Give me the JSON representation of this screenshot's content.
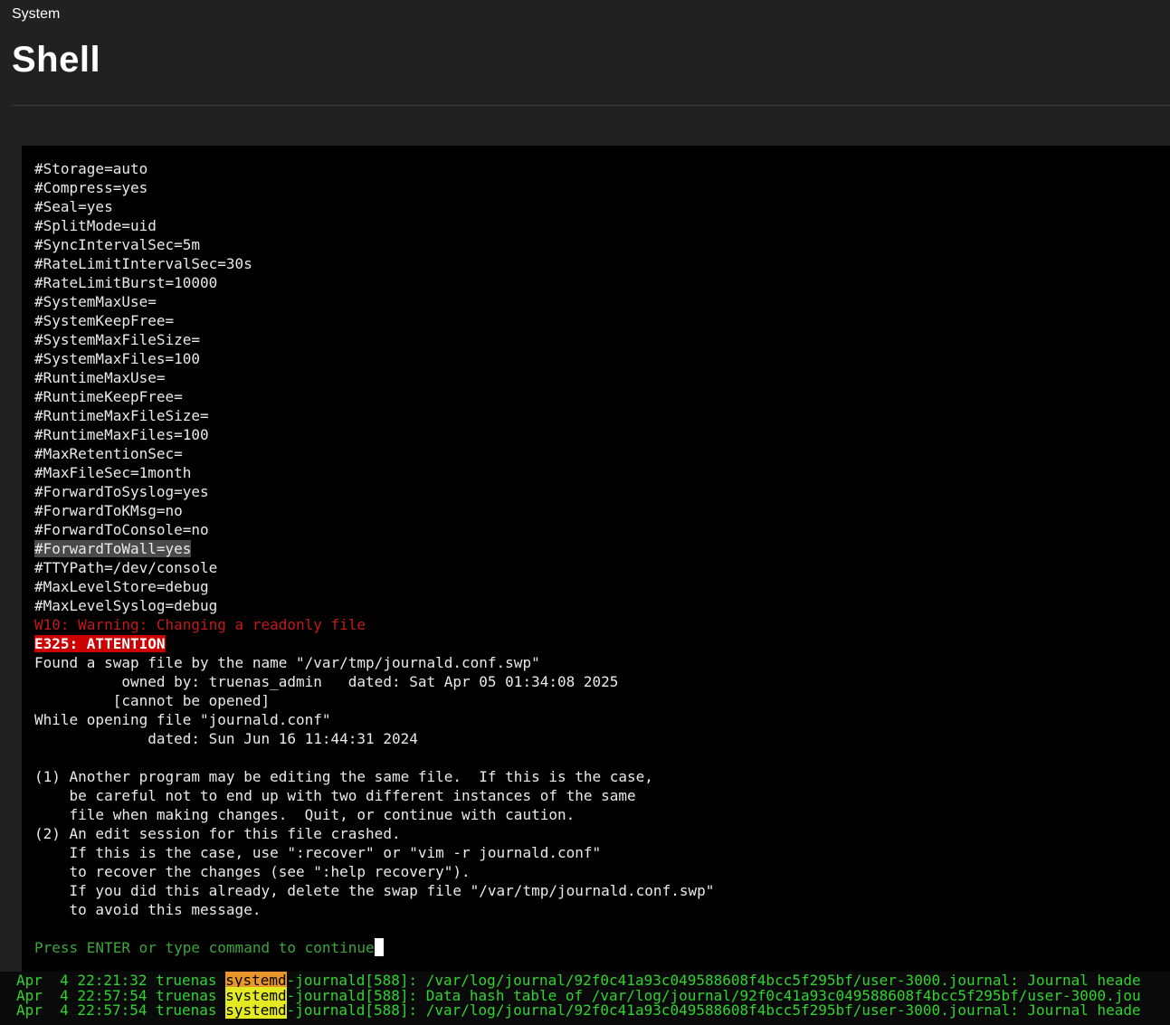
{
  "header": {
    "breadcrumb": "System",
    "title": "Shell"
  },
  "terminal": {
    "lines": [
      {
        "text": "#Storage=auto",
        "style": "normal"
      },
      {
        "text": "#Compress=yes",
        "style": "normal"
      },
      {
        "text": "#Seal=yes",
        "style": "normal"
      },
      {
        "text": "#SplitMode=uid",
        "style": "normal"
      },
      {
        "text": "#SyncIntervalSec=5m",
        "style": "normal"
      },
      {
        "text": "#RateLimitIntervalSec=30s",
        "style": "normal"
      },
      {
        "text": "#RateLimitBurst=10000",
        "style": "normal"
      },
      {
        "text": "#SystemMaxUse=",
        "style": "normal"
      },
      {
        "text": "#SystemKeepFree=",
        "style": "normal"
      },
      {
        "text": "#SystemMaxFileSize=",
        "style": "normal"
      },
      {
        "text": "#SystemMaxFiles=100",
        "style": "normal"
      },
      {
        "text": "#RuntimeMaxUse=",
        "style": "normal"
      },
      {
        "text": "#RuntimeKeepFree=",
        "style": "normal"
      },
      {
        "text": "#RuntimeMaxFileSize=",
        "style": "normal"
      },
      {
        "text": "#RuntimeMaxFiles=100",
        "style": "normal"
      },
      {
        "text": "#MaxRetentionSec=",
        "style": "normal"
      },
      {
        "text": "#MaxFileSec=1month",
        "style": "normal"
      },
      {
        "text": "#ForwardToSyslog=yes",
        "style": "normal"
      },
      {
        "text": "#ForwardToKMsg=no",
        "style": "normal"
      },
      {
        "text": "#ForwardToConsole=no",
        "style": "normal"
      },
      {
        "text": "#ForwardToWall=yes",
        "style": "highlighted"
      },
      {
        "text": "#TTYPath=/dev/console",
        "style": "normal"
      },
      {
        "text": "#MaxLevelStore=debug",
        "style": "normal"
      },
      {
        "text": "#MaxLevelSyslog=debug",
        "style": "normal"
      },
      {
        "text": "W10: Warning: Changing a readonly file",
        "style": "warning"
      },
      {
        "text": "E325: ATTENTION",
        "style": "error"
      },
      {
        "text": "Found a swap file by the name \"/var/tmp/journald.conf.swp\"",
        "style": "normal"
      },
      {
        "text": "          owned by: truenas_admin   dated: Sat Apr 05 01:34:08 2025",
        "style": "normal"
      },
      {
        "text": "         [cannot be opened]",
        "style": "normal"
      },
      {
        "text": "While opening file \"journald.conf\"",
        "style": "normal"
      },
      {
        "text": "             dated: Sun Jun 16 11:44:31 2024",
        "style": "normal"
      },
      {
        "text": "",
        "style": "normal"
      },
      {
        "text": "(1) Another program may be editing the same file.  If this is the case,",
        "style": "normal"
      },
      {
        "text": "    be careful not to end up with two different instances of the same",
        "style": "normal"
      },
      {
        "text": "    file when making changes.  Quit, or continue with caution.",
        "style": "normal"
      },
      {
        "text": "(2) An edit session for this file crashed.",
        "style": "normal"
      },
      {
        "text": "    If this is the case, use \":recover\" or \"vim -r journald.conf\"",
        "style": "normal"
      },
      {
        "text": "    to recover the changes (see \":help recovery\").",
        "style": "normal"
      },
      {
        "text": "    If you did this already, delete the swap file \"/var/tmp/journald.conf.swp\"",
        "style": "normal"
      },
      {
        "text": "    to avoid this message.",
        "style": "normal"
      },
      {
        "text": "",
        "style": "normal"
      },
      {
        "text": "Press ENTER or type command to continue",
        "style": "prompt"
      }
    ]
  },
  "log_panel": {
    "lines": [
      {
        "prefix": "Apr  4 22:21:32 truenas ",
        "highlight": "systemd",
        "highlight_color": "#e8962a",
        "suffix": "-journald[588]: /var/log/journal/92f0c41a93c049588608f4bcc5f295bf/user-3000.journal: Journal heade"
      },
      {
        "prefix": "Apr  4 22:57:54 truenas ",
        "highlight": "systemd",
        "highlight_color": "#e4ea22",
        "suffix": "-journald[588]: Data hash table of /var/log/journal/92f0c41a93c049588608f4bcc5f295bf/user-3000.jou"
      },
      {
        "prefix": "Apr  4 22:57:54 truenas ",
        "highlight": "systemd",
        "highlight_color": "#e4ea22",
        "suffix": "-journald[588]: /var/log/journal/92f0c41a93c049588608f4bcc5f295bf/user-3000.journal: Journal heade"
      }
    ]
  }
}
